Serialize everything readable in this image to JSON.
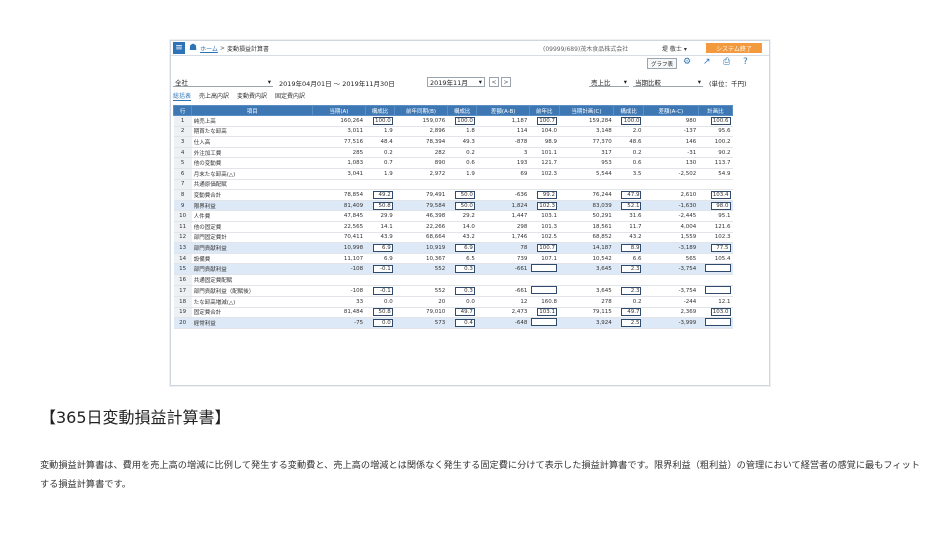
{
  "app": {
    "breadcrumb_home": "ホーム",
    "breadcrumb_sep": ">",
    "breadcrumb_current": "変動損益計算書",
    "company": "(09999/689)茂木食品株式会社",
    "user": "堤 敬士 ▾",
    "system_end": "システム終了",
    "graph_button": "グラフ表"
  },
  "filters": {
    "company_select": "全社",
    "period": "2019年04月01日 ～ 2019年11月30日",
    "month_select": "2019年11月",
    "prev": "<",
    "next": ">",
    "sales_ratio_select": "売上比",
    "comparison_select": "当期比較",
    "unit": "(単位：千円)"
  },
  "tabs": [
    {
      "label": "総括表",
      "active": true
    },
    {
      "label": "売上高内訳",
      "active": false
    },
    {
      "label": "変動費内訳",
      "active": false
    },
    {
      "label": "固定費内訳",
      "active": false
    }
  ],
  "columns": [
    "行",
    "項目",
    "当期(A)",
    "構成比",
    "前年同期(B)",
    "構成比",
    "差額(A-B)",
    "前年比",
    "当期計画(C)",
    "構成比",
    "差額(A-C)",
    "計画比"
  ],
  "rows": [
    {
      "no": "1",
      "item": "純売上高",
      "a": "160,264",
      "ra": "100.0",
      "b": "159,076",
      "rb": "100.0",
      "ab": "1,187",
      "yoy": "100.7",
      "c": "159,284",
      "rc": "100.0",
      "ac": "980",
      "plan": "100.6",
      "hl": false,
      "box": true
    },
    {
      "no": "2",
      "item": "期首たな卸高",
      "a": "3,011",
      "ra": "1.9",
      "b": "2,896",
      "rb": "1.8",
      "ab": "114",
      "yoy": "104.0",
      "c": "3,148",
      "rc": "2.0",
      "ac": "-137",
      "plan": "95.6",
      "hl": false,
      "box": false
    },
    {
      "no": "3",
      "item": "仕入高",
      "a": "77,516",
      "ra": "48.4",
      "b": "78,394",
      "rb": "49.3",
      "ab": "-878",
      "yoy": "98.9",
      "c": "77,370",
      "rc": "48.6",
      "ac": "146",
      "plan": "100.2",
      "hl": false,
      "box": false
    },
    {
      "no": "4",
      "item": "外注加工費",
      "a": "285",
      "ra": "0.2",
      "b": "282",
      "rb": "0.2",
      "ab": "3",
      "yoy": "101.1",
      "c": "317",
      "rc": "0.2",
      "ac": "-31",
      "plan": "90.2",
      "hl": false,
      "box": false
    },
    {
      "no": "5",
      "item": "他の変動費",
      "a": "1,083",
      "ra": "0.7",
      "b": "890",
      "rb": "0.6",
      "ab": "193",
      "yoy": "121.7",
      "c": "953",
      "rc": "0.6",
      "ac": "130",
      "plan": "113.7",
      "hl": false,
      "box": false
    },
    {
      "no": "6",
      "item": "月末たな卸高(△)",
      "a": "3,041",
      "ra": "1.9",
      "b": "2,972",
      "rb": "1.9",
      "ab": "69",
      "yoy": "102.3",
      "c": "5,544",
      "rc": "3.5",
      "ac": "-2,502",
      "plan": "54.9",
      "hl": false,
      "box": false
    },
    {
      "no": "7",
      "item": "共通原価配賦",
      "a": "",
      "ra": "",
      "b": "",
      "rb": "",
      "ab": "",
      "yoy": "",
      "c": "",
      "rc": "",
      "ac": "",
      "plan": "",
      "hl": false,
      "box": false
    },
    {
      "no": "8",
      "item": "変動費合計",
      "a": "78,854",
      "ra": "49.2",
      "b": "79,491",
      "rb": "50.0",
      "ab": "-636",
      "yoy": "99.2",
      "c": "76,244",
      "rc": "47.9",
      "ac": "2,610",
      "plan": "103.4",
      "hl": false,
      "box": true
    },
    {
      "no": "9",
      "item": "限界利益",
      "a": "81,409",
      "ra": "50.8",
      "b": "79,584",
      "rb": "50.0",
      "ab": "1,824",
      "yoy": "102.3",
      "c": "83,039",
      "rc": "52.1",
      "ac": "-1,630",
      "plan": "98.0",
      "hl": true,
      "box": true
    },
    {
      "no": "10",
      "item": "人件費",
      "a": "47,845",
      "ra": "29.9",
      "b": "46,398",
      "rb": "29.2",
      "ab": "1,447",
      "yoy": "103.1",
      "c": "50,291",
      "rc": "31.6",
      "ac": "-2,445",
      "plan": "95.1",
      "hl": false,
      "box": false
    },
    {
      "no": "11",
      "item": "他の固定費",
      "a": "22,565",
      "ra": "14.1",
      "b": "22,266",
      "rb": "14.0",
      "ab": "298",
      "yoy": "101.3",
      "c": "18,561",
      "rc": "11.7",
      "ac": "4,004",
      "plan": "121.6",
      "hl": false,
      "box": false
    },
    {
      "no": "12",
      "item": "部門固定費計",
      "a": "70,411",
      "ra": "43.9",
      "b": "68,664",
      "rb": "43.2",
      "ab": "1,746",
      "yoy": "102.5",
      "c": "68,852",
      "rc": "43.2",
      "ac": "1,559",
      "plan": "102.3",
      "hl": false,
      "box": false
    },
    {
      "no": "13",
      "item": "部門貢献利益",
      "a": "10,998",
      "ra": "6.9",
      "b": "10,919",
      "rb": "6.9",
      "ab": "78",
      "yoy": "100.7",
      "c": "14,187",
      "rc": "8.9",
      "ac": "-3,189",
      "plan": "77.5",
      "hl": true,
      "box": true
    },
    {
      "no": "14",
      "item": "設備費",
      "a": "11,107",
      "ra": "6.9",
      "b": "10,367",
      "rb": "6.5",
      "ab": "739",
      "yoy": "107.1",
      "c": "10,542",
      "rc": "6.6",
      "ac": "565",
      "plan": "105.4",
      "hl": false,
      "box": false
    },
    {
      "no": "15",
      "item": "部門貢献利益",
      "a": "-108",
      "ra": "-0.1",
      "b": "552",
      "rb": "0.3",
      "ab": "-661",
      "yoy": "",
      "c": "3,645",
      "rc": "2.3",
      "ac": "-3,754",
      "plan": "",
      "hl": true,
      "box": true
    },
    {
      "no": "16",
      "item": "共通固定費配賦",
      "a": "",
      "ra": "",
      "b": "",
      "rb": "",
      "ab": "",
      "yoy": "",
      "c": "",
      "rc": "",
      "ac": "",
      "plan": "",
      "hl": false,
      "box": false
    },
    {
      "no": "17",
      "item": "部門貢献利益（配賦後）",
      "a": "-108",
      "ra": "-0.1",
      "b": "552",
      "rb": "0.3",
      "ab": "-661",
      "yoy": "",
      "c": "3,645",
      "rc": "2.3",
      "ac": "-3,754",
      "plan": "",
      "hl": false,
      "box": true
    },
    {
      "no": "18",
      "item": "たな卸高増減(△)",
      "a": "33",
      "ra": "0.0",
      "b": "20",
      "rb": "0.0",
      "ab": "12",
      "yoy": "160.8",
      "c": "278",
      "rc": "0.2",
      "ac": "-244",
      "plan": "12.1",
      "hl": false,
      "box": false
    },
    {
      "no": "19",
      "item": "固定費合計",
      "a": "81,484",
      "ra": "50.8",
      "b": "79,010",
      "rb": "49.7",
      "ab": "2,473",
      "yoy": "103.1",
      "c": "79,115",
      "rc": "49.7",
      "ac": "2,369",
      "plan": "103.0",
      "hl": false,
      "box": true
    },
    {
      "no": "20",
      "item": "経常利益",
      "a": "-75",
      "ra": "0.0",
      "b": "573",
      "rb": "0.4",
      "ab": "-648",
      "yoy": "",
      "c": "3,924",
      "rc": "2.5",
      "ac": "-3,999",
      "plan": "",
      "hl": true,
      "box": true
    }
  ],
  "article": {
    "heading": "【365日変動損益計算書】",
    "body": "変動損益計算書は、費用を売上高の増減に比例して発生する変動費と、売上高の増減とは関係なく発生する固定費に分けて表示した損益計算書です。限界利益（粗利益）の管理において経営者の感覚に最もフィットする損益計算書です。"
  },
  "colors": {
    "accent": "#2e73b5",
    "header": "#3d78b4",
    "highlight": "#dde9f6",
    "system_end": "#f29a3d"
  }
}
